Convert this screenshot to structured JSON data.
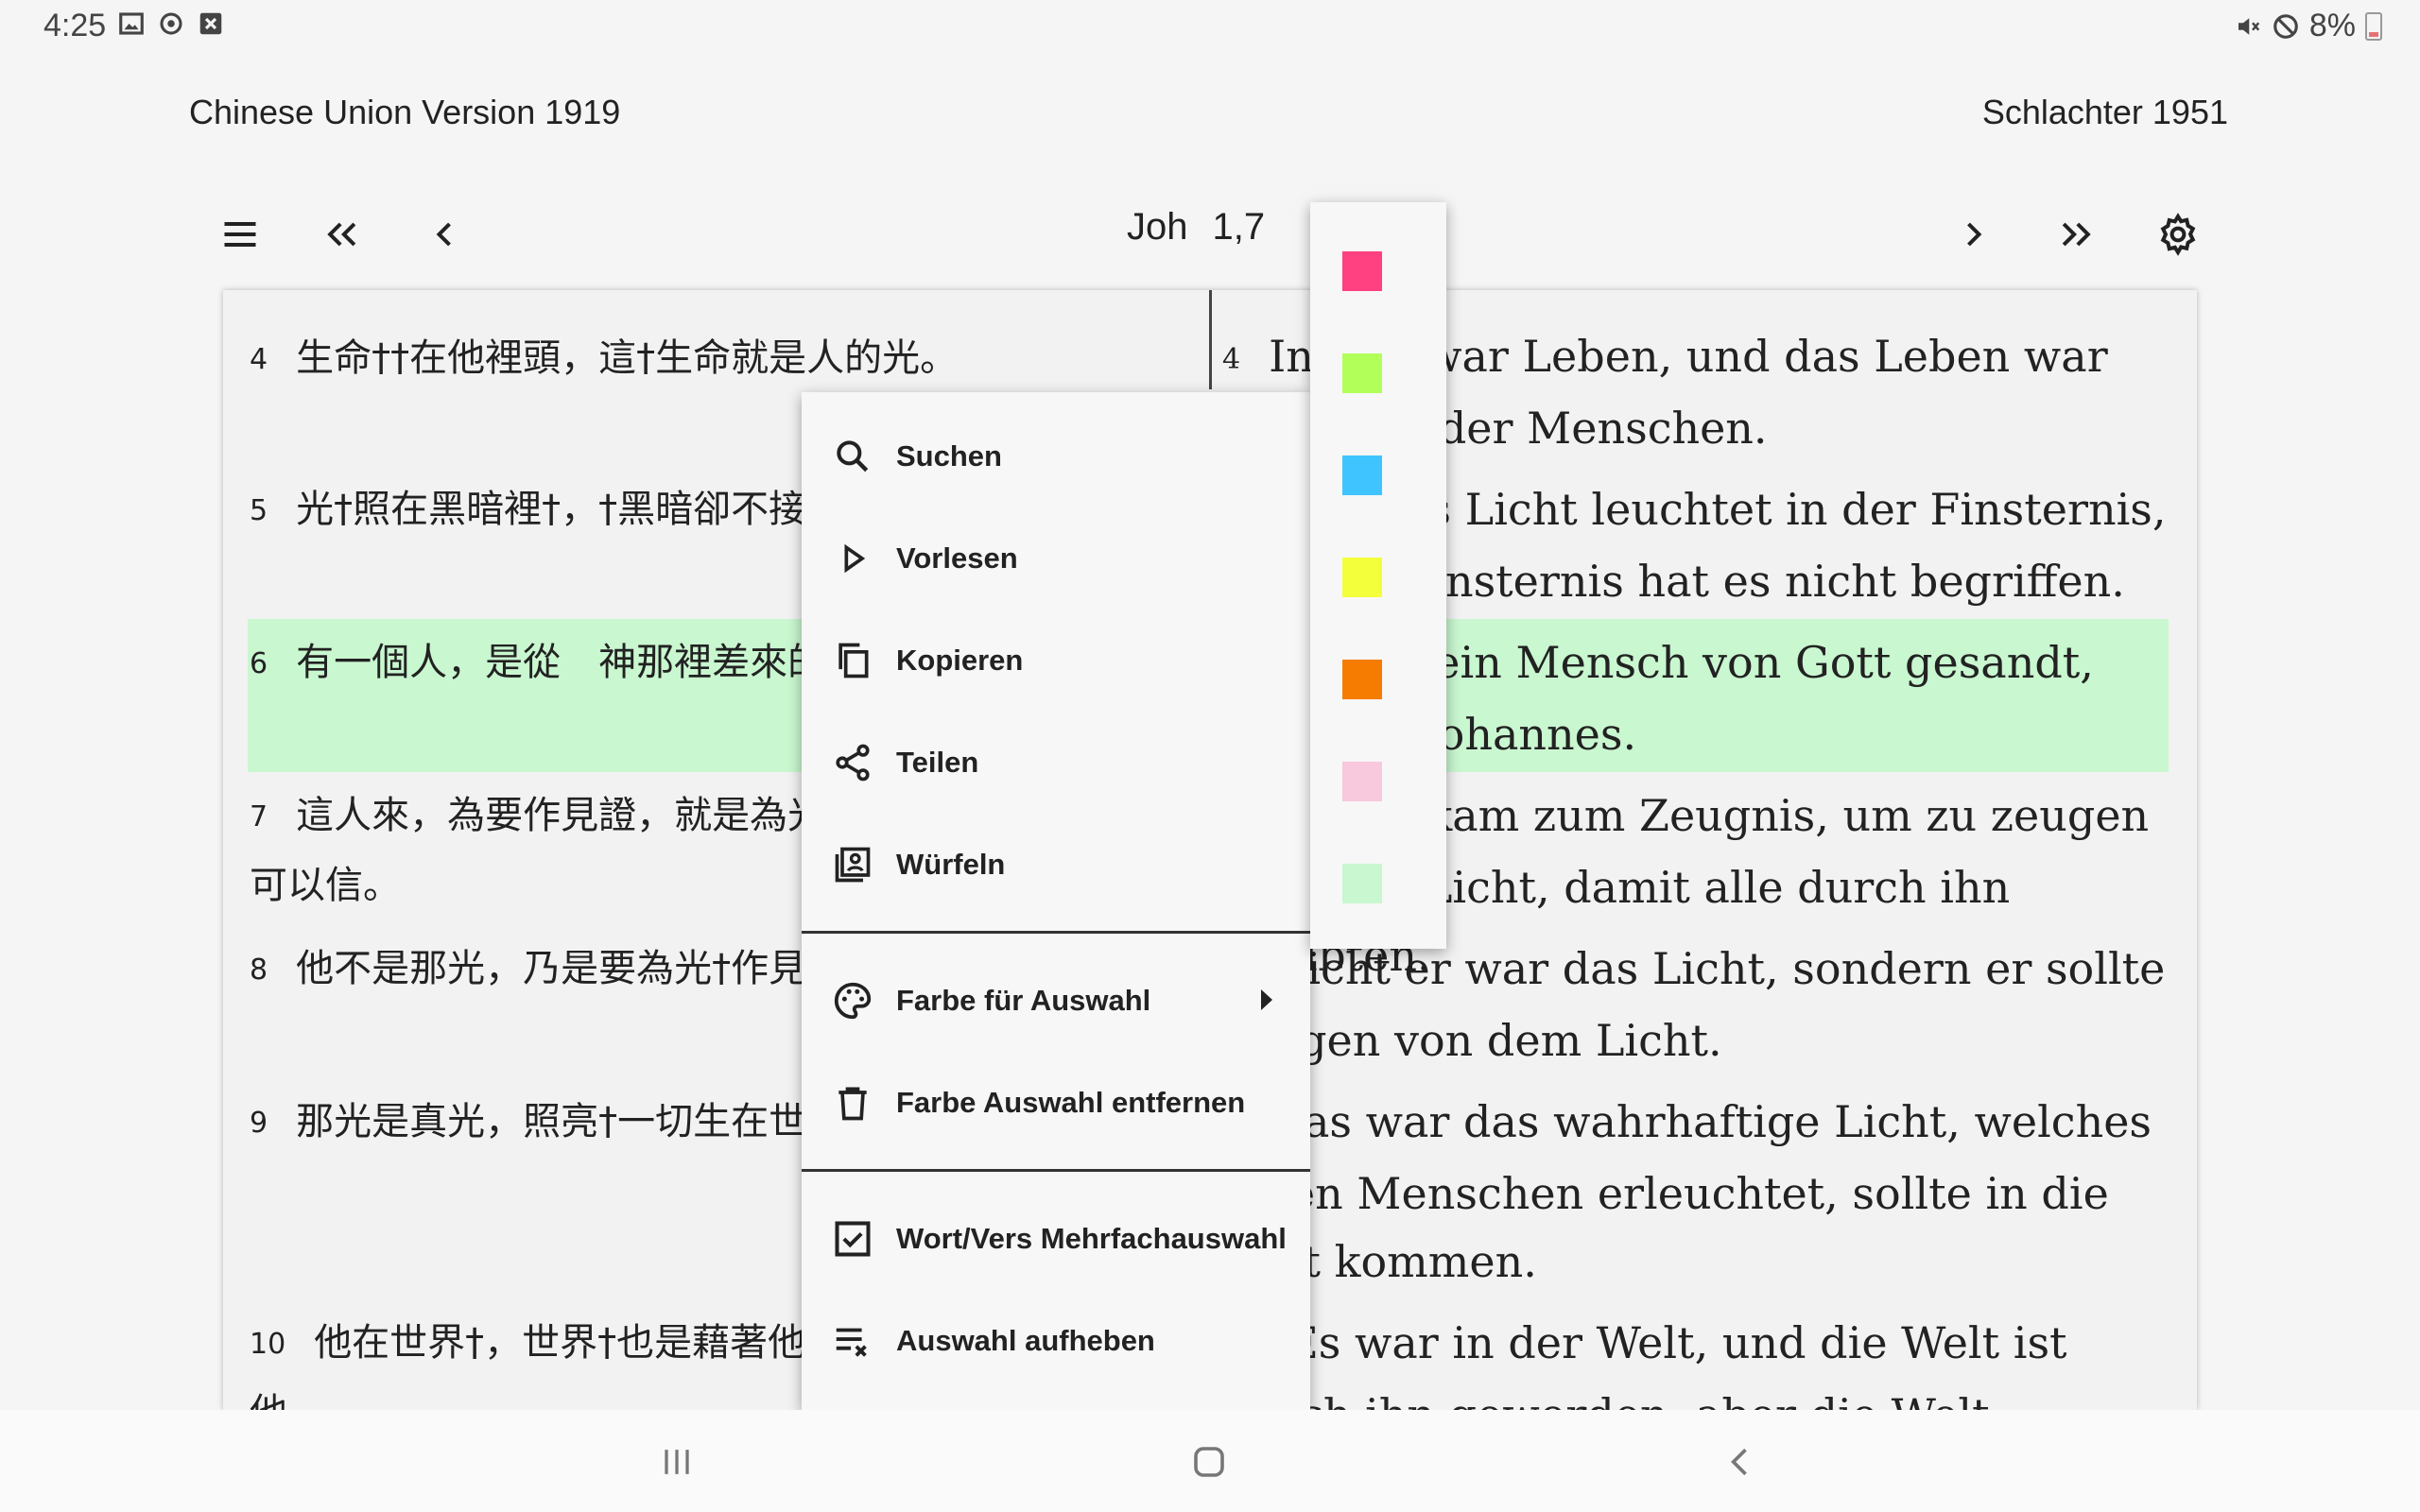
{
  "status_bar": {
    "time": "4:25",
    "left_icons": [
      "image-icon",
      "sync-icon",
      "close-box-icon"
    ],
    "right_icons": [
      "mute-vibrate-icon",
      "do-not-disturb-icon"
    ],
    "battery": "8%"
  },
  "versions": {
    "left": "Chinese Union Version 1919",
    "right": "Schlachter 1951"
  },
  "toolbar": {
    "book": "Joh",
    "chapter_verse": "1,7",
    "icons": [
      "menu-icon",
      "double-chevron-left-icon",
      "chevron-left-icon",
      "chevron-right-icon",
      "double-chevron-right-icon",
      "gear-icon"
    ]
  },
  "left_verses": [
    {
      "num": "4",
      "text": "生命††在他裡頭，這†生命就是人的光。"
    },
    {
      "num": "5",
      "text": "光†照在黑暗裡†，†黑暗卻不接受光。"
    },
    {
      "num": "6",
      "text": "有一個人，是從　神那裡差來的，名叫約翰。"
    },
    {
      "num": "7",
      "text": "這人來，為要作見證，就是為光作見證，叫眾人因他可以信。"
    },
    {
      "num": "8",
      "text": "他不是那光，乃是要為光†作見證。"
    },
    {
      "num": "9",
      "text": "那光是真光，照亮†一切生在世上的人。"
    },
    {
      "num": "10",
      "text": "他在世界†，世界†也是藉著他造的，世界卻不認識他。"
    }
  ],
  "right_verses": [
    {
      "num": "4",
      "text": "In ihm war Leben, und das Leben war das Licht der Menschen."
    },
    {
      "num": "5",
      "text": "Und das Licht leuchtet in der Finsternis, und die Finsternis hat es nicht begriffen."
    },
    {
      "num": "6",
      "text": "Es war ein Mensch von Gott gesandt, der hieß Johannes."
    },
    {
      "num": "7",
      "text": "Dieser kam zum Zeugnis, um zu zeugen von dem Licht, damit alle durch ihn glaubten."
    },
    {
      "num": "8",
      "text": "Nicht er war das Licht, sondern er sollte zeugen von dem Licht."
    },
    {
      "num": "9",
      "text": "Das war das wahrhaftige Licht, welches jeden Menschen erleuchtet, sollte in die Welt kommen."
    },
    {
      "num": "10",
      "text": "Es war in der Welt, und die Welt ist durch ihn geworden, aber die Welt erkannte ihn nicht."
    }
  ],
  "menu": {
    "items": [
      {
        "label": "Suchen",
        "icon": "search-icon"
      },
      {
        "label": "Vorlesen",
        "icon": "play-icon"
      },
      {
        "label": "Kopieren",
        "icon": "copy-icon"
      },
      {
        "label": "Teilen",
        "icon": "share-icon"
      },
      {
        "label": "Würfeln",
        "icon": "portrait-icon"
      },
      {
        "label": "Farbe für Auswahl",
        "icon": "palette-icon"
      },
      {
        "label": "Farbe Auswahl entfernen",
        "icon": "trash-icon"
      },
      {
        "label": "Wort/Vers Mehrfachauswahl",
        "icon": "checkbox-icon"
      },
      {
        "label": "Auswahl aufheben",
        "icon": "clear-list-icon"
      }
    ]
  },
  "palette": {
    "colors": [
      "#ff4081",
      "#b2ff59",
      "#40c4ff",
      "#f4ff3b",
      "#f57c00",
      "#f8c8dc",
      "#c9f7d0"
    ]
  },
  "highlight_colors": {
    "yellow": "#f4fb3b",
    "green": "#c9f7d0"
  },
  "navigation_bar": {
    "icons": [
      "recent-apps-icon",
      "home-icon",
      "back-icon"
    ]
  }
}
